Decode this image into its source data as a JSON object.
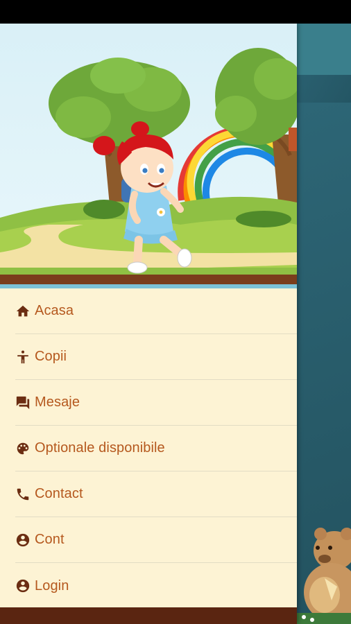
{
  "theme": {
    "label_color": "#b5581e",
    "icon_color": "#6b2d12",
    "drawer_bg": "#fdf3d4",
    "footer_color": "#5a2511",
    "background_teal": "#2f6f7d"
  },
  "menu": {
    "items": [
      {
        "label": "Acasa",
        "icon": "home-icon"
      },
      {
        "label": "Copii",
        "icon": "person-icon"
      },
      {
        "label": "Mesaje",
        "icon": "messages-icon"
      },
      {
        "label": "Optionale disponibile",
        "icon": "palette-icon"
      },
      {
        "label": "Contact",
        "icon": "phone-icon"
      },
      {
        "label": "Cont",
        "icon": "account-circle-icon"
      },
      {
        "label": "Login",
        "icon": "account-circle-icon"
      }
    ]
  }
}
